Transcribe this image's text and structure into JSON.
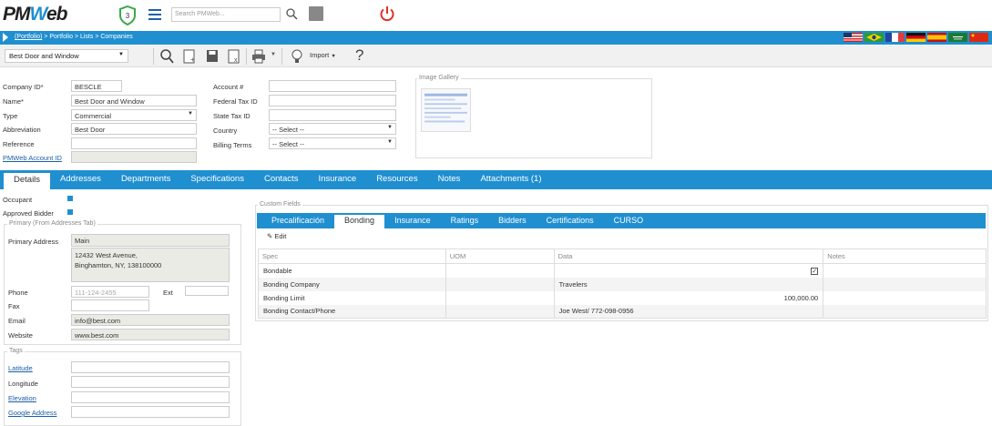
{
  "app": {
    "logo_a": "PM",
    "logo_b": "W",
    "logo_c": "eb",
    "badge_count": "3",
    "search_placeholder": "Search PMWeb..."
  },
  "breadcrumb": {
    "root": "(Portfolio)",
    "rest": " > Portfolio > Lists > Companies"
  },
  "toolbar": {
    "record": "Best Door and Window",
    "import_label": "Import",
    "help": "?"
  },
  "header_form": {
    "company_id_label": "Company ID*",
    "company_id": "BESCLE",
    "name_label": "Name*",
    "name": "Best Door and Window",
    "type_label": "Type",
    "type": "Commercial",
    "abbrev_label": "Abbreviation",
    "abbrev": "Best Door",
    "reference_label": "Reference",
    "reference": "",
    "pmweb_account_label": "PMWeb Account ID",
    "pmweb_account": "",
    "account_label": "Account #",
    "account": "",
    "fed_tax_label": "Federal Tax ID",
    "fed_tax": "",
    "state_tax_label": "State Tax ID",
    "state_tax": "",
    "country_label": "Country",
    "country": "-- Select --",
    "billing_label": "Billing Terms",
    "billing": "-- Select --",
    "gallery_label": "Image Gallery"
  },
  "tabs": [
    "Details",
    "Addresses",
    "Departments",
    "Specifications",
    "Contacts",
    "Insurance",
    "Resources",
    "Notes",
    "Attachments (1)"
  ],
  "details": {
    "occupant_label": "Occupant",
    "approved_label": "Approved Bidder",
    "primary_group": "Primary (From Addresses Tab)",
    "primary_address_label": "Primary Address",
    "primary_address_type": "Main",
    "address_line1": "12432 West Avenue,",
    "address_line2": "Binghamton, NY, 138100000",
    "phone_label": "Phone",
    "phone_placeholder": "111-124-2455",
    "ext_label": "Ext",
    "fax_label": "Fax",
    "email_label": "Email",
    "email": "info@best.com",
    "website_label": "Website",
    "website": "www.best.com",
    "tags_group": "Tags",
    "latitude_label": "Latitude",
    "longitude_label": "Longitude",
    "elevation_label": "Elevation",
    "google_label": "Google Address"
  },
  "custom_fields": {
    "title": "Custom Fields",
    "tabs": [
      "Precalificación",
      "Bonding",
      "Insurance",
      "Ratings",
      "Bidders",
      "Certifications",
      "CURSO"
    ],
    "edit_label": "Edit",
    "columns": [
      "Spec",
      "UOM",
      "Data",
      "Notes"
    ],
    "rows": [
      {
        "spec": "Bondable",
        "uom": "",
        "data": "✓",
        "notes": ""
      },
      {
        "spec": "Bonding Company",
        "uom": "",
        "data": "Travelers",
        "notes": ""
      },
      {
        "spec": "Bonding Limit",
        "uom": "",
        "data": "100,000.00",
        "notes": ""
      },
      {
        "spec": "Bonding Contact/Phone",
        "uom": "",
        "data": "Joe West/ 772-098-0956",
        "notes": ""
      }
    ]
  },
  "colors": {
    "accent": "#1f8fd0",
    "power": "#e0312a"
  }
}
